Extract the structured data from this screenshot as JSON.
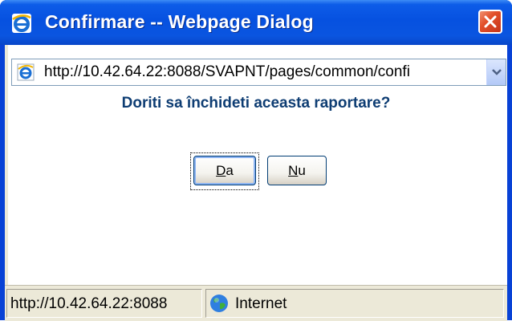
{
  "window": {
    "title": "Confirmare -- Webpage Dialog",
    "title_icon": "ie-icon",
    "close_icon": "close-icon"
  },
  "address_bar": {
    "url": "http://10.42.64.22:8088/SVAPNT/pages/common/confi",
    "icon": "ie-page-icon",
    "dropdown_icon": "chevron-down-icon"
  },
  "dialog": {
    "message": "Doriti sa închideti aceasta raportare?",
    "buttons": [
      {
        "label_hotkey": "D",
        "label_rest": "a"
      },
      {
        "label_hotkey": "N",
        "label_rest": "u"
      }
    ]
  },
  "status_bar": {
    "url": "http://10.42.64.22:8088",
    "zone": "Internet",
    "zone_icon": "globe-icon"
  },
  "colors": {
    "title_bar": "#0651e0",
    "close_button": "#e2502a",
    "message_text": "#0e3d73",
    "client_bg": "#ece9d8"
  }
}
